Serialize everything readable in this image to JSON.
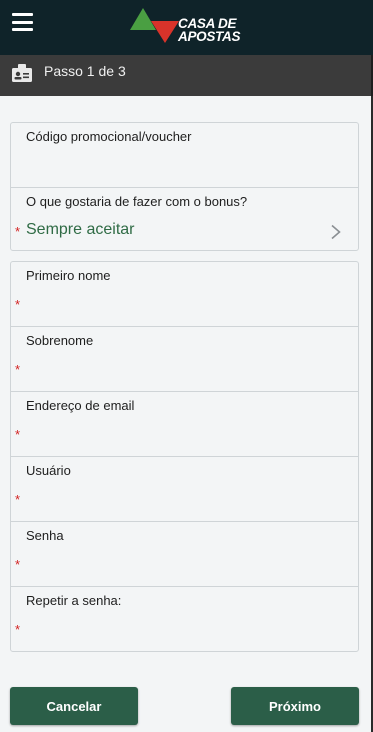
{
  "header": {
    "logo_line1": "CASA DE",
    "logo_line2": "APOSTAS",
    "logo_green": "#4a9f42",
    "logo_red": "#d8332a"
  },
  "stepper": {
    "label": "Passo 1 de 3"
  },
  "promo": {
    "code_label": "Código promocional/voucher",
    "bonus_label": "O que gostaria de fazer com o bonus?",
    "bonus_value": "Sempre aceitar"
  },
  "fields": [
    {
      "label": "Primeiro nome"
    },
    {
      "label": "Sobrenome"
    },
    {
      "label": "Endereço de email"
    },
    {
      "label": "Usuário"
    },
    {
      "label": "Senha"
    },
    {
      "label": "Repetir a senha:"
    }
  ],
  "required_mark": "*",
  "actions": {
    "cancel": "Cancelar",
    "next": "Próximo"
  },
  "colors": {
    "header_bg": "#0f2329",
    "stepbar_bg": "#3b3b3b",
    "button_bg": "#2b5e48",
    "accent_text": "#2f6b45",
    "required": "#d32222"
  }
}
